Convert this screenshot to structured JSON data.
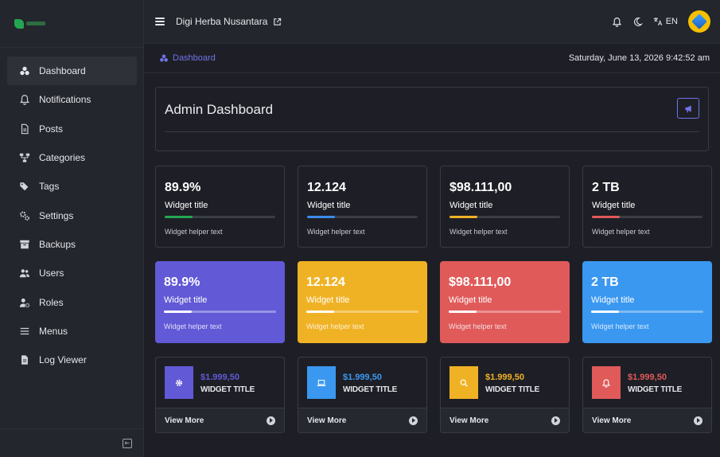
{
  "header": {
    "site_name": "Digi Herba Nusantara",
    "language": "EN"
  },
  "sidebar": {
    "items": [
      {
        "label": "Dashboard",
        "icon": "dashboard-icon",
        "active": true
      },
      {
        "label": "Notifications",
        "icon": "bell-icon"
      },
      {
        "label": "Posts",
        "icon": "document-icon"
      },
      {
        "label": "Categories",
        "icon": "sitemap-icon"
      },
      {
        "label": "Tags",
        "icon": "tags-icon"
      },
      {
        "label": "Settings",
        "icon": "cogs-icon"
      },
      {
        "label": "Backups",
        "icon": "archive-icon"
      },
      {
        "label": "Users",
        "icon": "users-icon"
      },
      {
        "label": "Roles",
        "icon": "user-cog-icon"
      },
      {
        "label": "Menus",
        "icon": "menu-icon"
      },
      {
        "label": "Log Viewer",
        "icon": "file-icon"
      }
    ]
  },
  "breadcrumb": {
    "label": "Dashboard"
  },
  "datetime": "Saturday, June 13, 2026 9:42:52 am",
  "page": {
    "title": "Admin Dashboard"
  },
  "colors": {
    "accent": "#6f73e8",
    "green": "#22a652",
    "blue": "#3b8beb",
    "yellow": "#f0b225",
    "red": "#e05a5a",
    "purple": "#6159d6",
    "sky": "#3a98f0"
  },
  "widgets_outline": [
    {
      "value": "89.9%",
      "title": "Widget title",
      "helper": "Widget helper text",
      "progress": 0.25,
      "color": "#22a652"
    },
    {
      "value": "12.124",
      "title": "Widget title",
      "helper": "Widget helper text",
      "progress": 0.25,
      "color": "#3b8beb"
    },
    {
      "value": "$98.111,00",
      "title": "Widget title",
      "helper": "Widget helper text",
      "progress": 0.25,
      "color": "#f0b225"
    },
    {
      "value": "2 TB",
      "title": "Widget title",
      "helper": "Widget helper text",
      "progress": 0.25,
      "color": "#e05a5a"
    }
  ],
  "widgets_filled": [
    {
      "value": "89.9%",
      "title": "Widget title",
      "helper": "Widget helper text",
      "progress": 0.25,
      "bg": "#6159d6"
    },
    {
      "value": "12.124",
      "title": "Widget title",
      "helper": "Widget helper text",
      "progress": 0.25,
      "bg": "#f0b225"
    },
    {
      "value": "$98.111,00",
      "title": "Widget title",
      "helper": "Widget helper text",
      "progress": 0.25,
      "bg": "#e05a5a"
    },
    {
      "value": "2 TB",
      "title": "Widget title",
      "helper": "Widget helper text",
      "progress": 0.25,
      "bg": "#3a98f0"
    }
  ],
  "stat_cards": [
    {
      "amount": "$1.999,50",
      "label": "WIDGET TITLE",
      "more": "View More",
      "icon": "gear-icon",
      "color": "#6159d6"
    },
    {
      "amount": "$1.999,50",
      "label": "WIDGET TITLE",
      "more": "View More",
      "icon": "laptop-icon",
      "color": "#3a98f0"
    },
    {
      "amount": "$1.999,50",
      "label": "WIDGET TITLE",
      "more": "View More",
      "icon": "search-icon",
      "color": "#f0b225"
    },
    {
      "amount": "$1.999,50",
      "label": "WIDGET TITLE",
      "more": "View More",
      "icon": "bell-icon",
      "color": "#e05a5a"
    }
  ]
}
